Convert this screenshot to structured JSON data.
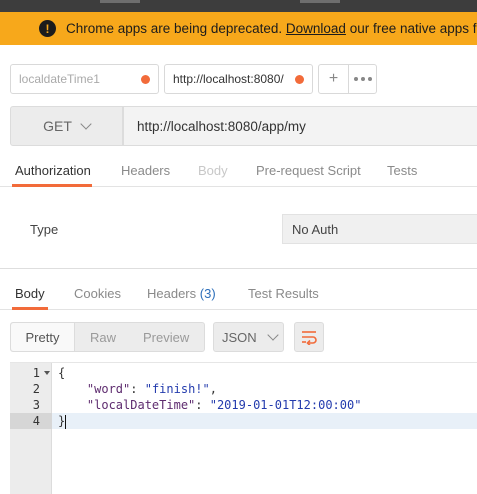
{
  "banner": {
    "text_before": "Chrome apps are being deprecated. ",
    "link": "Download",
    "text_after": " our free native apps for co"
  },
  "tabs": [
    {
      "label": "localdateTime1"
    },
    {
      "label": "http://localhost:8080/"
    }
  ],
  "tab_actions": {
    "add": "+"
  },
  "request": {
    "method": "GET",
    "url": "http://localhost:8080/app/my"
  },
  "request_tabs": [
    "Authorization",
    "Headers",
    "Body",
    "Pre-request Script",
    "Tests"
  ],
  "auth": {
    "type_label": "Type",
    "type_value": "No Auth"
  },
  "response_tabs": {
    "body": "Body",
    "cookies": "Cookies",
    "headers": "Headers",
    "headers_count": "(3)",
    "test_results": "Test Results"
  },
  "view_modes": [
    "Pretty",
    "Raw",
    "Preview"
  ],
  "format": "JSON",
  "response_body": {
    "line_numbers": [
      "1",
      "2",
      "3",
      "4"
    ],
    "open_brace": "{",
    "close_brace": "}",
    "key1": "\"word\"",
    "val1": "\"finish!\"",
    "key2": "\"localDateTime\"",
    "val2": "\"2019-01-01T12:00:00\""
  },
  "colors": {
    "accent": "#f26b3a",
    "banner": "#f7a81b",
    "headers_count": "#2d6fba"
  }
}
